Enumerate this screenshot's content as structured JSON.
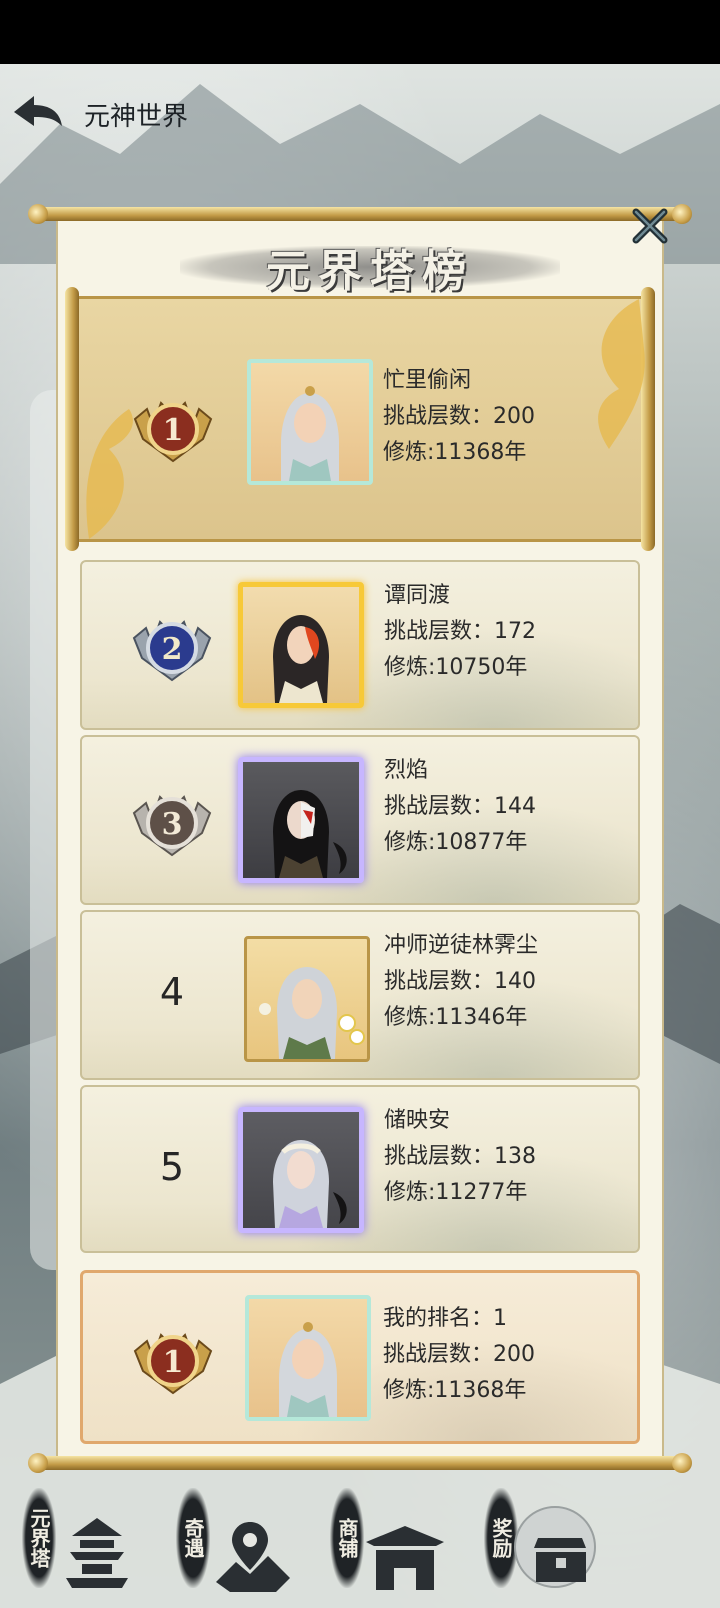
{
  "header": {
    "title": "元神世界"
  },
  "dialog": {
    "title": "元界塔榜",
    "labels": {
      "floors_prefix": "挑战层数：",
      "cultivation_prefix": "修炼:"
    },
    "entries": [
      {
        "rank": "1",
        "name": "忙里偷闲",
        "floors": "挑战层数：200",
        "cultivation": "修炼:11368年"
      },
      {
        "rank": "2",
        "name": "谭同渡",
        "floors": "挑战层数：172",
        "cultivation": "修炼:10750年"
      },
      {
        "rank": "3",
        "name": "烈焰",
        "floors": "挑战层数：144",
        "cultivation": "修炼:10877年"
      },
      {
        "rank": "4",
        "name": "冲师逆徒林霁尘",
        "floors": "挑战层数：140",
        "cultivation": "修炼:11346年"
      },
      {
        "rank": "5",
        "name": "储映安",
        "floors": "挑战层数：138",
        "cultivation": "修炼:11277年"
      }
    ],
    "my_rank": {
      "rank": "1",
      "label": "我的排名：1",
      "floors": "挑战层数：200",
      "cultivation": "修炼:11368年"
    }
  },
  "dock": [
    {
      "label": "元界塔",
      "icon": "tower-icon"
    },
    {
      "label": "奇遇",
      "icon": "map-pin-icon"
    },
    {
      "label": "商铺",
      "icon": "shop-icon"
    },
    {
      "label": "奖励",
      "icon": "chest-icon"
    }
  ],
  "colors": {
    "gold": "#c39b47",
    "bronze": "#8b2e1f",
    "silver": "#9aa3ad",
    "blue_badge": "#2b3b8e"
  }
}
